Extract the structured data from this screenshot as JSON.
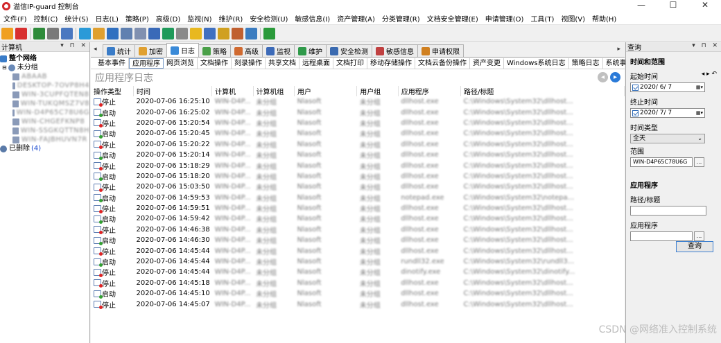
{
  "window": {
    "title": "溢信IP-guard 控制台",
    "controls": [
      "—",
      "☐",
      "✕"
    ]
  },
  "menu": [
    "文件(F)",
    "控制(C)",
    "统计(S)",
    "日志(L)",
    "策略(P)",
    "高级(D)",
    "监视(N)",
    "维护(R)",
    "安全检测(U)",
    "敏感信息(I)",
    "资产管理(A)",
    "分类管理(R)",
    "文档安全管理(E)",
    "申请管理(O)",
    "工具(T)",
    "视图(V)",
    "帮助(H)"
  ],
  "toolbar": {
    "icons": [
      "new-group-icon",
      "delete-icon",
      "import-icon",
      "print-icon",
      "print-preview-icon",
      "globe-icon",
      "user-icon",
      "database-icon",
      "save-icon",
      "copy-icon",
      "monitor-icon",
      "network-icon",
      "disk-icon",
      "warning-icon",
      "chart-icon",
      "lock-icon",
      "edit-icon",
      "device-icon",
      "refresh-icon"
    ],
    "colors": [
      "#f0a020",
      "#d83030",
      "#2e8b3a",
      "#7a7a7a",
      "#4a78c0",
      "#2a9ad8",
      "#e0a030",
      "#3070c0",
      "#6080b0",
      "#8090b0",
      "#3a6ab8",
      "#1f9a5a",
      "#8a8a8a",
      "#e8b820",
      "#4070c0",
      "#d0a020",
      "#c06030",
      "#3b7cc0",
      "#2a9a3a"
    ]
  },
  "left_panel": {
    "title": "计算机",
    "controls": "▾ ⊓ ✕",
    "root": "整个网络",
    "group": "未分组",
    "computers": [
      "ABAAB",
      "DESKTOP-7OVP8H4",
      "WIN-3CUPFQTEN8",
      "WIN-TUKQMSZ7V8",
      "WIN-D4P65C78U6G",
      "WIN-CHGEFKNP8",
      "WIN-SSGKQTTN8H",
      "WIN-FAJBHUVN7R"
    ],
    "deleted_label": "已删除",
    "deleted_count": "(4)"
  },
  "tabs": [
    {
      "label": "统计",
      "icon": "statistics-icon",
      "color": "#3a7cc8"
    },
    {
      "label": "加密",
      "icon": "lock-icon",
      "color": "#e0a030"
    },
    {
      "label": "日志",
      "icon": "log-icon",
      "color": "#3a8ad8"
    },
    {
      "label": "策略",
      "icon": "policy-icon",
      "color": "#4aa048"
    },
    {
      "label": "高级",
      "icon": "advanced-icon",
      "color": "#d06a30"
    },
    {
      "label": "监视",
      "icon": "monitor-icon",
      "color": "#3c6ab8"
    },
    {
      "label": "维护",
      "icon": "maintenance-icon",
      "color": "#2f9a4a"
    },
    {
      "label": "安全检测",
      "icon": "security-check-icon",
      "color": "#3a6ab0"
    },
    {
      "label": "敏感信息",
      "icon": "sensitive-info-icon",
      "color": "#c04040"
    },
    {
      "label": "申请权限",
      "icon": "request-permission-icon",
      "color": "#d08020"
    }
  ],
  "subtabs": [
    "基本事件",
    "应用程序",
    "网页浏览",
    "文档操作",
    "刻录操作",
    "共享文档",
    "远程桌面",
    "文档打印",
    "移动存储操作",
    "文档云备份操作",
    "资产变更",
    "Windows系统日志",
    "策略日志",
    "系统事件"
  ],
  "log": {
    "title": "应用程序日志",
    "columns": [
      "操作类型",
      "时间",
      "计算机",
      "计算机组",
      "用户",
      "用户组",
      "应用程序",
      "路径/标题"
    ],
    "rows": [
      {
        "type": "停止",
        "time": "2020-07-06 16:25:10",
        "computer": "WIN-D4P...",
        "group": "未分组",
        "user": "Nlasoft",
        "ugroup": "未分组",
        "app": "dllhost.exe",
        "path": "C:\\Windows\\System32\\dllhost..."
      },
      {
        "type": "启动",
        "time": "2020-07-06 16:25:02",
        "computer": "WIN-D4P...",
        "group": "未分组",
        "user": "Nlasoft",
        "ugroup": "未分组",
        "app": "dllhost.exe",
        "path": "C:\\Windows\\System32\\dllhost..."
      },
      {
        "type": "停止",
        "time": "2020-07-06 15:20:54",
        "computer": "WIN-D4P...",
        "group": "未分组",
        "user": "Nlasoft",
        "ugroup": "未分组",
        "app": "dllhost.exe",
        "path": "C:\\Windows\\System32\\dllhost..."
      },
      {
        "type": "启动",
        "time": "2020-07-06 15:20:45",
        "computer": "WIN-D4P...",
        "group": "未分组",
        "user": "Nlasoft",
        "ugroup": "未分组",
        "app": "dllhost.exe",
        "path": "C:\\Windows\\System32\\dllhost..."
      },
      {
        "type": "停止",
        "time": "2020-07-06 15:20:22",
        "computer": "WIN-D4P...",
        "group": "未分组",
        "user": "Nlasoft",
        "ugroup": "未分组",
        "app": "dllhost.exe",
        "path": "C:\\Windows\\System32\\dllhost..."
      },
      {
        "type": "启动",
        "time": "2020-07-06 15:20:14",
        "computer": "WIN-D4P...",
        "group": "未分组",
        "user": "Nlasoft",
        "ugroup": "未分组",
        "app": "dllhost.exe",
        "path": "C:\\Windows\\System32\\dllhost..."
      },
      {
        "type": "停止",
        "time": "2020-07-06 15:18:29",
        "computer": "WIN-D4P...",
        "group": "未分组",
        "user": "Nlasoft",
        "ugroup": "未分组",
        "app": "dllhost.exe",
        "path": "C:\\Windows\\System32\\dllhost..."
      },
      {
        "type": "启动",
        "time": "2020-07-06 15:18:20",
        "computer": "WIN-D4P...",
        "group": "未分组",
        "user": "Nlasoft",
        "ugroup": "未分组",
        "app": "dllhost.exe",
        "path": "C:\\Windows\\System32\\dllhost..."
      },
      {
        "type": "停止",
        "time": "2020-07-06 15:03:50",
        "computer": "WIN-D4P...",
        "group": "未分组",
        "user": "Nlasoft",
        "ugroup": "未分组",
        "app": "dllhost.exe",
        "path": "C:\\Windows\\System32\\dllhost..."
      },
      {
        "type": "启动",
        "time": "2020-07-06 14:59:53",
        "computer": "WIN-D4P...",
        "group": "未分组",
        "user": "Nlasoft",
        "ugroup": "未分组",
        "app": "notepad.exe",
        "path": "C:\\Windows\\System32\\notepa..."
      },
      {
        "type": "停止",
        "time": "2020-07-06 14:59:51",
        "computer": "WIN-D4P...",
        "group": "未分组",
        "user": "Nlasoft",
        "ugroup": "未分组",
        "app": "dllhost.exe",
        "path": "C:\\Windows\\System32\\dllhost..."
      },
      {
        "type": "启动",
        "time": "2020-07-06 14:59:42",
        "computer": "WIN-D4P...",
        "group": "未分组",
        "user": "Nlasoft",
        "ugroup": "未分组",
        "app": "dllhost.exe",
        "path": "C:\\Windows\\System32\\dllhost..."
      },
      {
        "type": "停止",
        "time": "2020-07-06 14:46:38",
        "computer": "WIN-D4P...",
        "group": "未分组",
        "user": "Nlasoft",
        "ugroup": "未分组",
        "app": "dllhost.exe",
        "path": "C:\\Windows\\System32\\dllhost..."
      },
      {
        "type": "启动",
        "time": "2020-07-06 14:46:30",
        "computer": "WIN-D4P...",
        "group": "未分组",
        "user": "Nlasoft",
        "ugroup": "未分组",
        "app": "dllhost.exe",
        "path": "C:\\Windows\\System32\\dllhost..."
      },
      {
        "type": "停止",
        "time": "2020-07-06 14:45:44",
        "computer": "WIN-D4P...",
        "group": "未分组",
        "user": "Nlasoft",
        "ugroup": "未分组",
        "app": "dllhost.exe",
        "path": "C:\\Windows\\System32\\dllhost..."
      },
      {
        "type": "启动",
        "time": "2020-07-06 14:45:44",
        "computer": "WIN-D4P...",
        "group": "未分组",
        "user": "Nlasoft",
        "ugroup": "未分组",
        "app": "rundll32.exe",
        "path": "C:\\Windows\\System32\\rundll3..."
      },
      {
        "type": "停止",
        "time": "2020-07-06 14:45:44",
        "computer": "WIN-D4P...",
        "group": "未分组",
        "user": "Nlasoft",
        "ugroup": "未分组",
        "app": "dinotify.exe",
        "path": "C:\\Windows\\System32\\dinotify..."
      },
      {
        "type": "停止",
        "time": "2020-07-06 14:45:18",
        "computer": "WIN-D4P...",
        "group": "未分组",
        "user": "Nlasoft",
        "ugroup": "未分组",
        "app": "dllhost.exe",
        "path": "C:\\Windows\\System32\\dllhost..."
      },
      {
        "type": "启动",
        "time": "2020-07-06 14:45:10",
        "computer": "WIN-D4P...",
        "group": "未分组",
        "user": "Nlasoft",
        "ugroup": "未分组",
        "app": "dllhost.exe",
        "path": "C:\\Windows\\System32\\dllhost..."
      },
      {
        "type": "停止",
        "time": "2020-07-06 14:45:07",
        "computer": "WIN-D4P...",
        "group": "未分组",
        "user": "Nlasoft",
        "ugroup": "未分组",
        "app": "dllhost.exe",
        "path": "C:\\Windows\\System32\\dllhost..."
      }
    ]
  },
  "query_panel": {
    "title": "查询",
    "controls": "▾ ⊓ ✕",
    "section_time": "时间和范围",
    "start_label": "起始时间",
    "start_value": "2020/ 6/ 7",
    "end_label": "终止时间",
    "end_value": "2020/ 7/ 7",
    "time_type_label": "时间类型",
    "time_type_value": "全天",
    "scope_label": "范围",
    "scope_value": "WIN-D4P65C78U6G",
    "section_app": "应用程序",
    "path_label": "路径/标题",
    "app_label": "应用程序",
    "query_button": "查询",
    "nav_arrows": "◂ ▸ ↶"
  },
  "watermark": "CSDN @网络准入控制系统"
}
